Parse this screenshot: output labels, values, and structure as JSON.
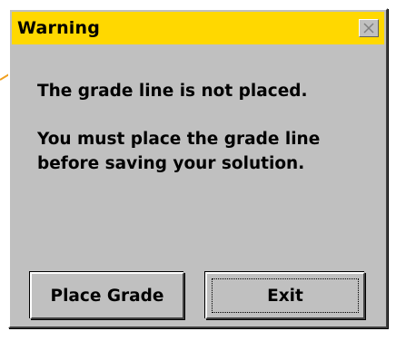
{
  "dialog": {
    "title": "Warning",
    "close_icon": "close-x-icon",
    "title_color": "#ffd800",
    "messages": {
      "line1": "The grade line is not placed.",
      "line2": "You must place the grade line",
      "line3": "before saving your solution."
    },
    "buttons": {
      "place_grade": "Place Grade",
      "exit": "Exit"
    }
  }
}
